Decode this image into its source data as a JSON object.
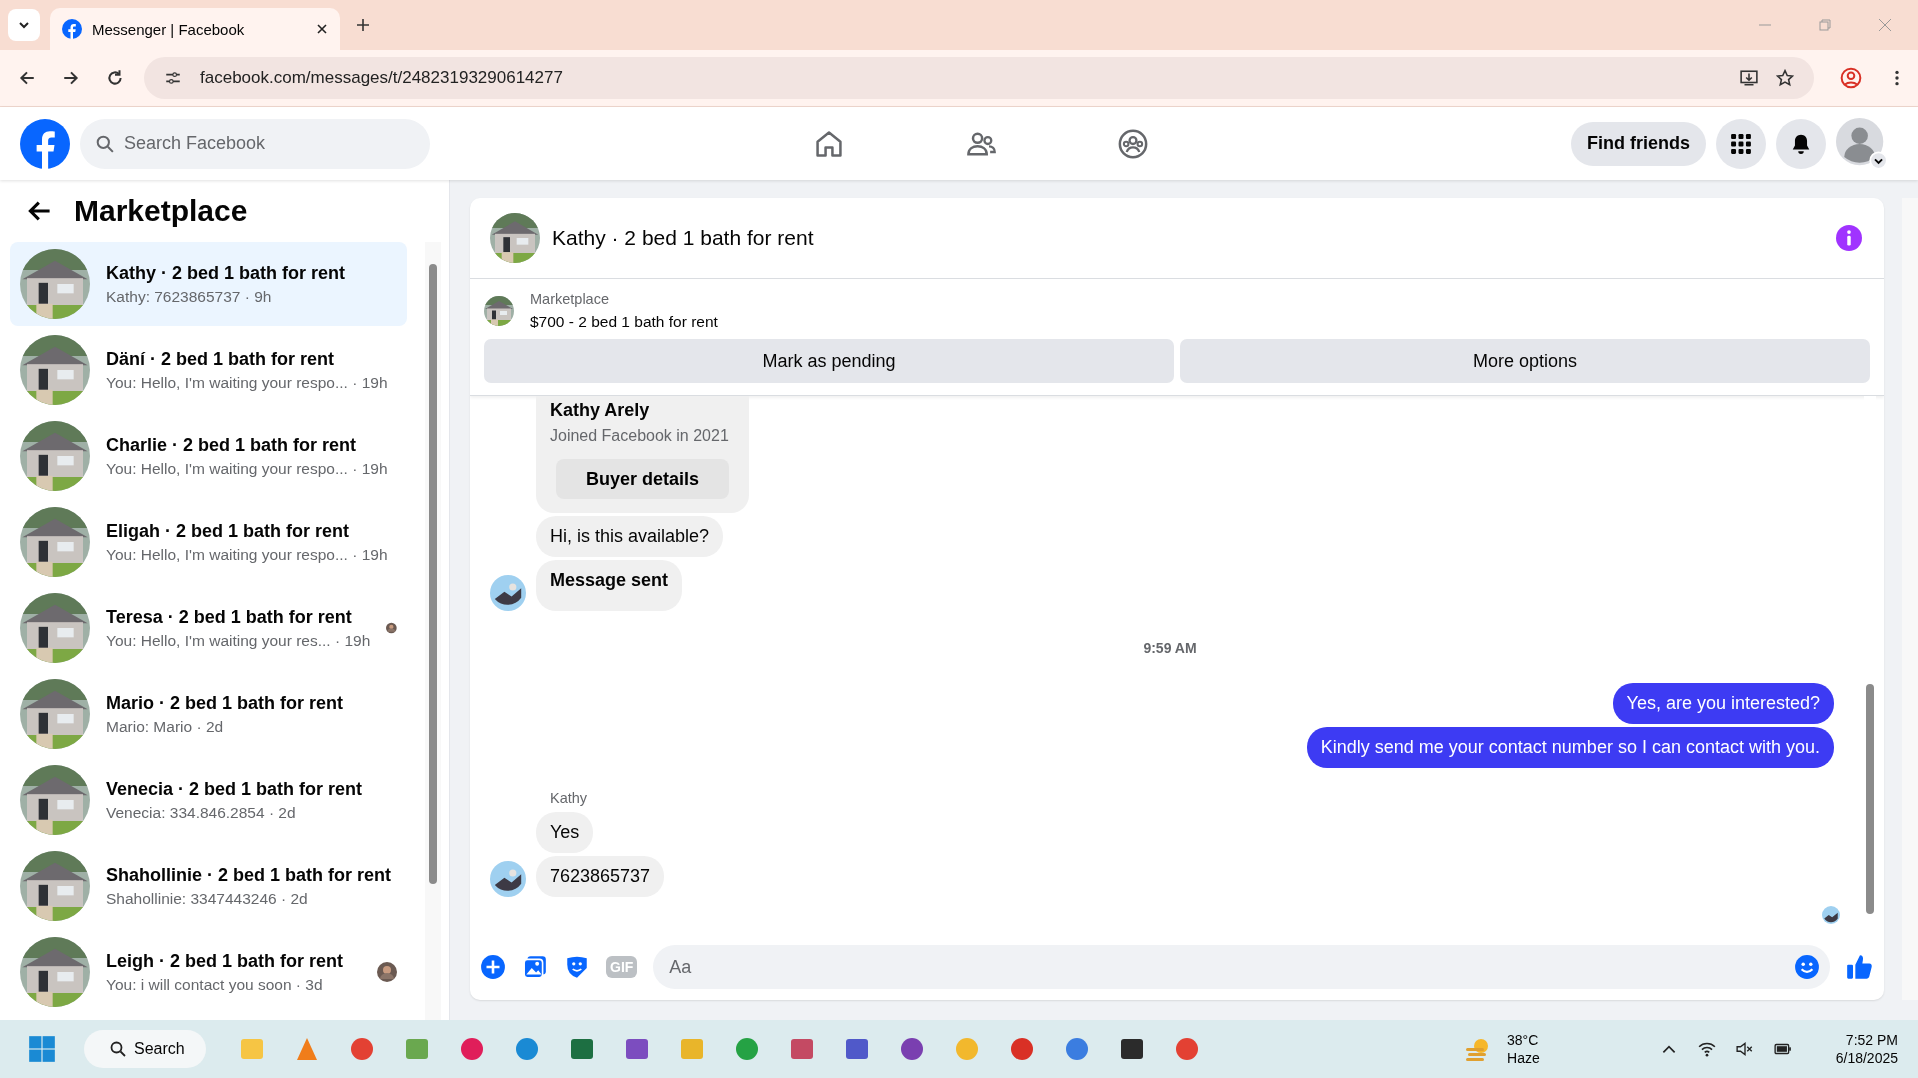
{
  "browser": {
    "tab_title": "Messenger | Facebook",
    "url": "facebook.com/messages/t/24823193290614277"
  },
  "header": {
    "search_placeholder": "Search Facebook",
    "find_friends": "Find friends"
  },
  "sidebar": {
    "title": "Marketplace",
    "conversations": [
      {
        "title": "Kathy · 2 bed 1 bath for rent",
        "preview": "Kathy: 7623865737",
        "time": "· 9h",
        "selected": true,
        "seen_avatar": false
      },
      {
        "title": "Däní · 2 bed 1 bath for rent",
        "preview": "You: Hello, I'm waiting your respo...",
        "time": "· 19h",
        "selected": false,
        "seen_avatar": false
      },
      {
        "title": "Charlie · 2 bed 1 bath for rent",
        "preview": "You: Hello, I'm waiting your respo...",
        "time": "· 19h",
        "selected": false,
        "seen_avatar": false
      },
      {
        "title": "Eligah · 2 bed 1 bath for rent",
        "preview": "You: Hello, I'm waiting your respo...",
        "time": "· 19h",
        "selected": false,
        "seen_avatar": false
      },
      {
        "title": "Teresa · 2 bed 1 bath for rent",
        "preview": "You: Hello, I'm waiting your res...",
        "time": "· 19h",
        "selected": false,
        "seen_avatar": true
      },
      {
        "title": "Mario · 2 bed 1 bath for rent",
        "preview": "Mario: Mario",
        "time": "· 2d",
        "selected": false,
        "seen_avatar": false
      },
      {
        "title": "Venecia · 2 bed 1 bath for rent",
        "preview": "Venecia: 334.846.2854",
        "time": "· 2d",
        "selected": false,
        "seen_avatar": false
      },
      {
        "title": "Shahollinie · 2 bed 1 bath for rent",
        "preview": "Shahollinie: 3347443246",
        "time": "· 2d",
        "selected": false,
        "seen_avatar": false
      },
      {
        "title": "Leigh · 2 bed 1 bath for rent",
        "preview": "You: i will contact you soon",
        "time": "· 3d",
        "selected": false,
        "seen_avatar": true
      }
    ]
  },
  "chat": {
    "title": "Kathy · 2 bed 1 bath for rent",
    "listing": {
      "label": "Marketplace",
      "text": "$700 - 2 bed 1 bath for rent"
    },
    "actions": [
      "Mark as pending",
      "More options"
    ],
    "buyer": {
      "name": "Kathy Arely",
      "joined": "Joined Facebook in 2021",
      "button": "Buyer details"
    },
    "messages": [
      {
        "kind": "incoming",
        "text": "Hi, is this available?",
        "bold": false,
        "avatar": false
      },
      {
        "kind": "incoming",
        "text": "Message sent",
        "bold": true,
        "avatar": true
      },
      {
        "kind": "timestamp",
        "text": "9:59 AM"
      },
      {
        "kind": "outgoing",
        "text": "Yes, are you interested?"
      },
      {
        "kind": "outgoing",
        "text": "Kindly send me your contact number so I can contact with you."
      },
      {
        "kind": "sender",
        "text": "Kathy"
      },
      {
        "kind": "incoming",
        "text": "Yes",
        "bold": false,
        "avatar": false
      },
      {
        "kind": "incoming",
        "text": "7623865737",
        "bold": false,
        "avatar": true
      }
    ],
    "composer": {
      "gif_label": "GIF",
      "placeholder": "Aa"
    }
  },
  "taskbar": {
    "search": "Search",
    "temperature": "38°C",
    "weather": "Haze",
    "time": "7:52 PM",
    "date": "6/18/2025"
  }
}
